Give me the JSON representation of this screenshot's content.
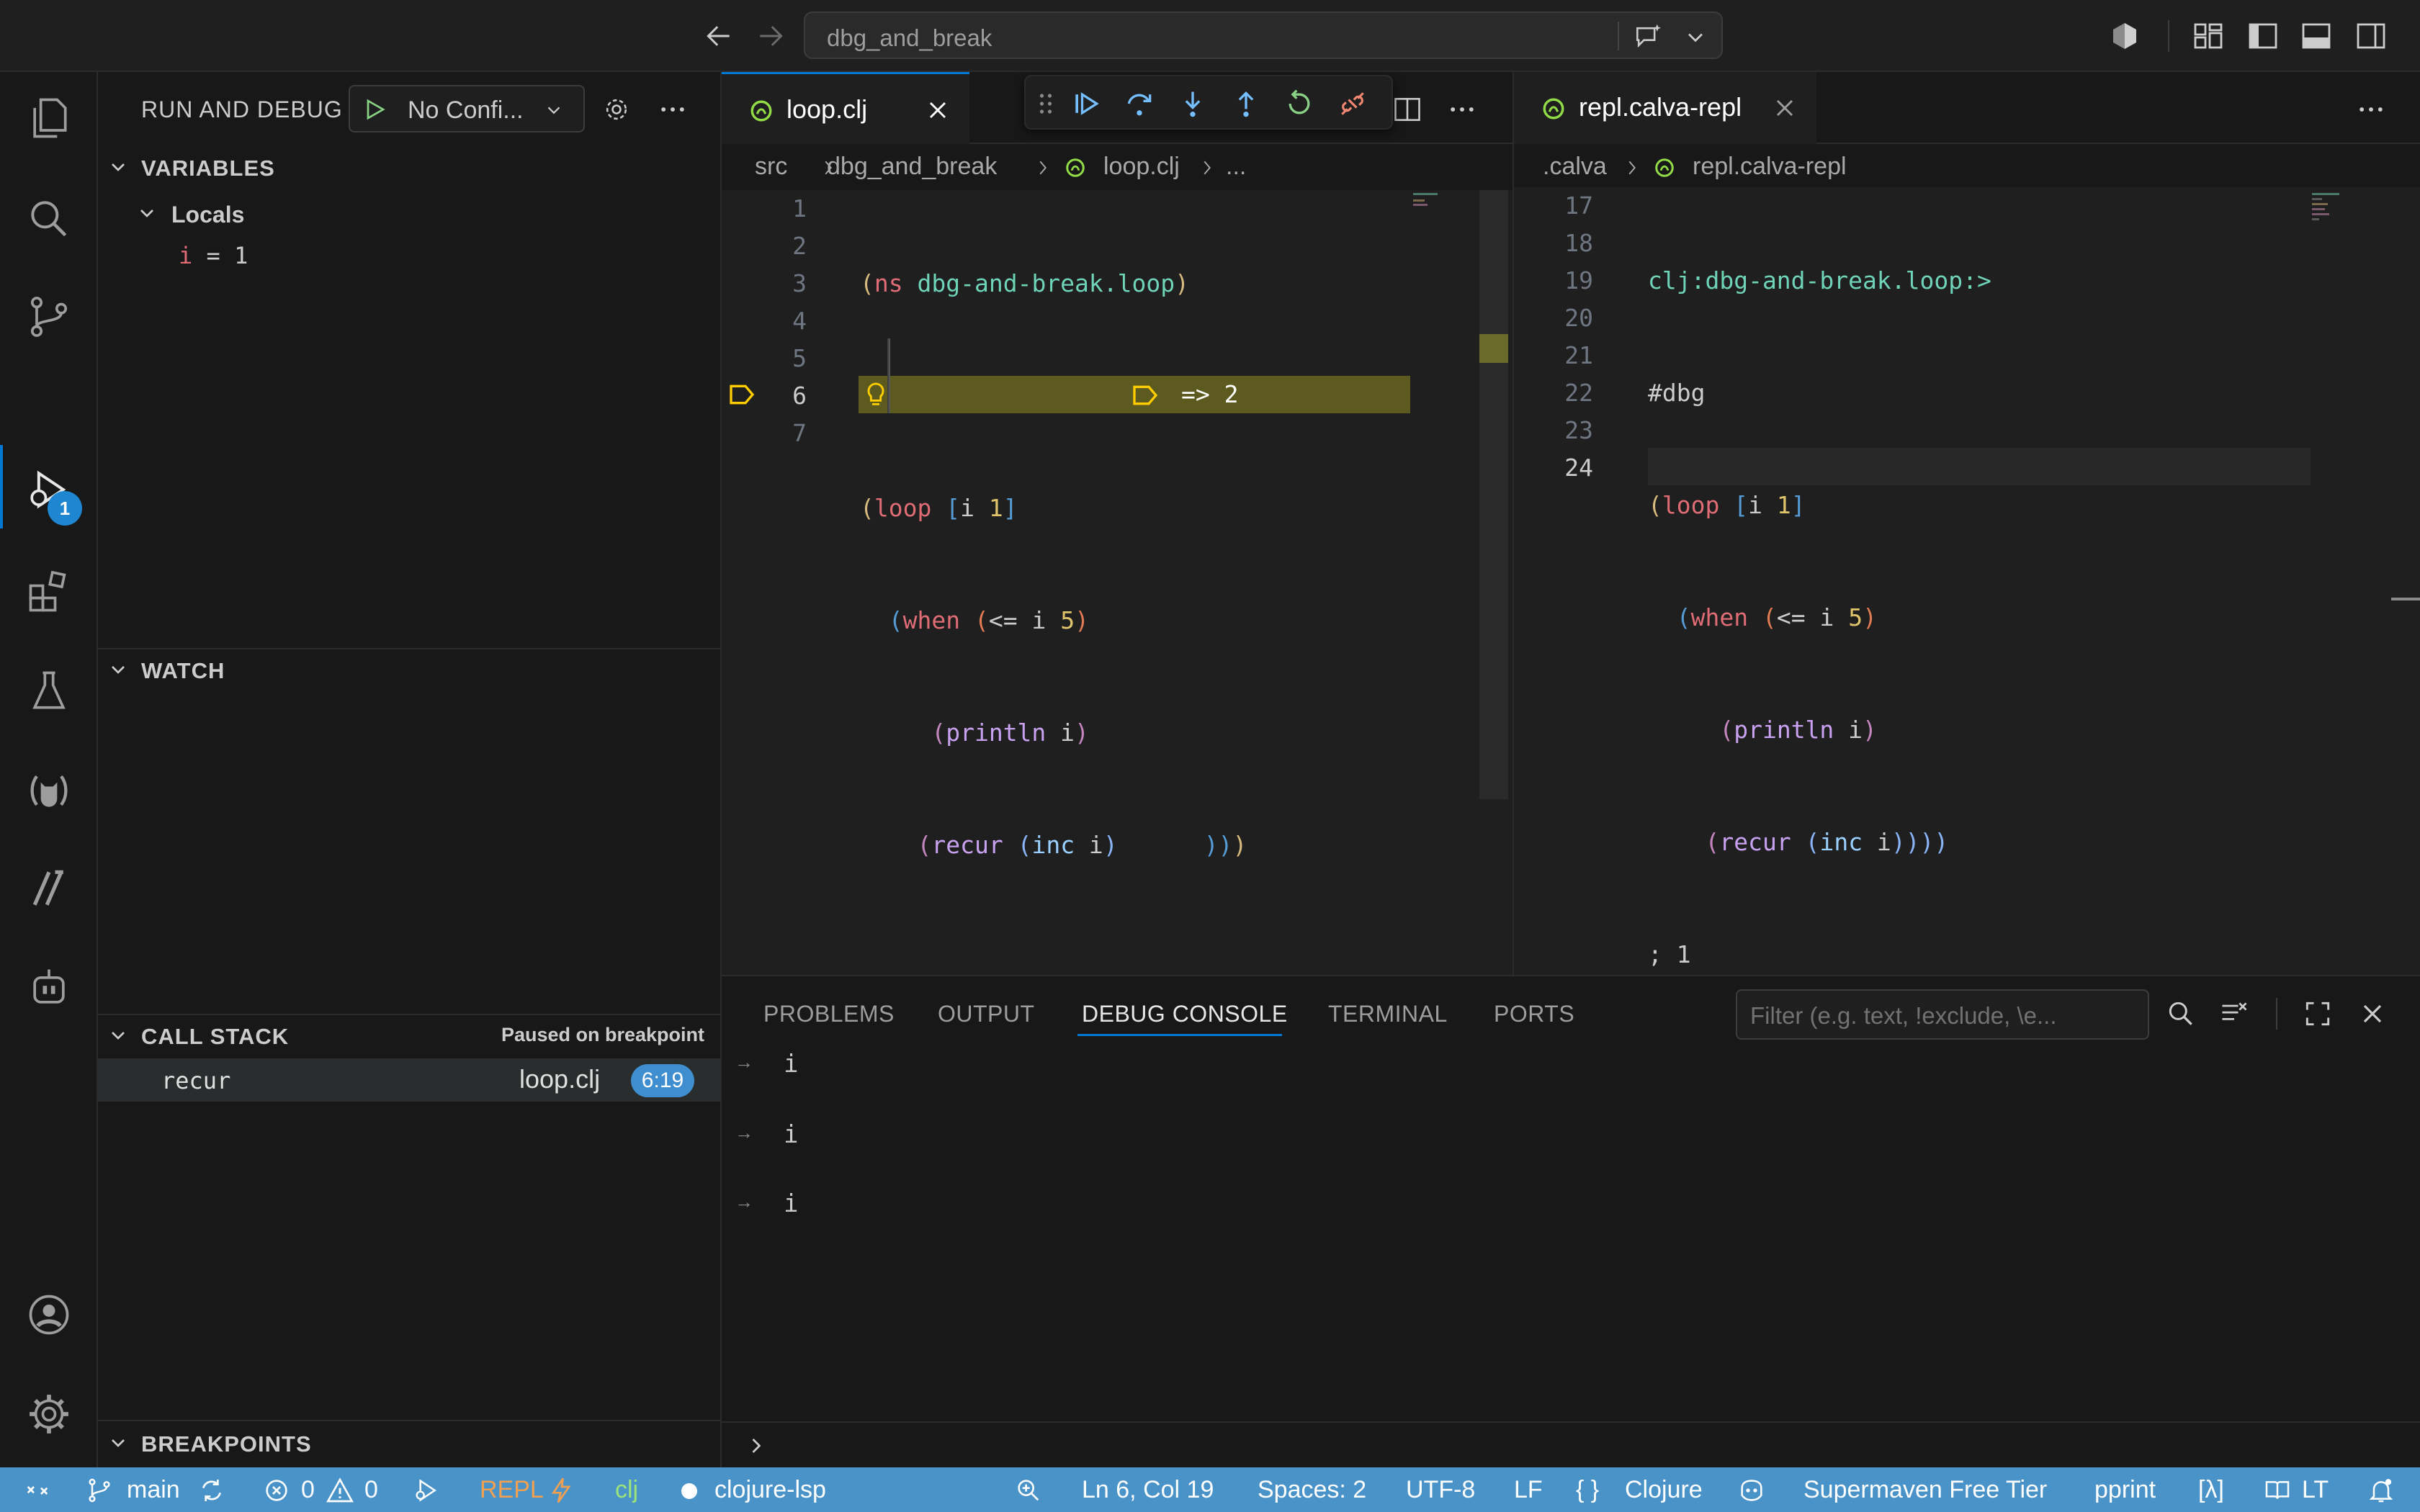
{
  "titlebar": {
    "search_text": "dbg_and_break"
  },
  "sidebar": {
    "title": "RUN AND DEBUG",
    "config_label": "No Confi...",
    "variables": {
      "header": "VARIABLES",
      "locals_label": "Locals",
      "vars": [
        {
          "name": "i",
          "eq": " = ",
          "value": "1"
        }
      ]
    },
    "watch": {
      "header": "WATCH"
    },
    "call_stack": {
      "header": "CALL STACK",
      "status": "Paused on breakpoint",
      "frames": [
        {
          "fn": "recur",
          "file": "loop.clj",
          "pos": "6:19"
        }
      ]
    },
    "breakpoints": {
      "header": "BREAKPOINTS"
    }
  },
  "editor_left": {
    "tab_name": "loop.clj",
    "breadcrumb": [
      "src",
      "dbg_and_break",
      "loop.clj",
      "..."
    ],
    "line_numbers": [
      "1",
      "2",
      "3",
      "4",
      "5",
      "6",
      "7"
    ],
    "current_line": "6",
    "inline_value": "=> 2",
    "tokens": {
      "l1": [
        "(",
        "ns",
        " ",
        "dbg-and-break.loop",
        ")"
      ],
      "l3": [
        "(",
        "loop",
        " ",
        "[",
        "i",
        " ",
        "1",
        "]"
      ],
      "l4": [
        "(",
        "when",
        " ",
        "(",
        "<=",
        " i ",
        "5",
        ")"
      ],
      "l5": [
        "(",
        "println",
        " i",
        ")"
      ],
      "l6": [
        "(",
        "recur",
        " ",
        "(",
        "inc",
        " i",
        ")",
        "))",
        ")"
      ]
    }
  },
  "editor_right": {
    "tab_name": "repl.calva-repl",
    "breadcrumb": [
      ".calva",
      "repl.calva-repl"
    ],
    "line_numbers": [
      "17",
      "18",
      "19",
      "20",
      "21",
      "22",
      "23",
      "24"
    ],
    "lines": {
      "l17": "clj:dbg-and-break.loop:>",
      "l18": "#dbg",
      "l19": [
        "(",
        "loop",
        " ",
        "[",
        "i",
        " ",
        "1",
        "]"
      ],
      "l20": [
        "(",
        "when",
        " ",
        "(",
        "<=",
        " i ",
        "5",
        ")"
      ],
      "l21": [
        "(",
        "println",
        " i",
        ")"
      ],
      "l22": [
        "(",
        "recur",
        " ",
        "(",
        "inc",
        " i",
        "))))"
      ],
      "l23": "; 1"
    }
  },
  "panel": {
    "tabs": [
      "PROBLEMS",
      "OUTPUT",
      "DEBUG CONSOLE",
      "TERMINAL",
      "PORTS"
    ],
    "active_tab": "DEBUG CONSOLE",
    "filter_placeholder": "Filter (e.g. text, !exclude, \\e...",
    "console_lines": [
      "i",
      "i",
      "i"
    ]
  },
  "statusbar": {
    "branch": "main",
    "errors": "0",
    "warnings": "0",
    "repl": "REPL",
    "lang_short": "clj",
    "lsp": "clojure-lsp",
    "position": "Ln 6, Col 19",
    "spaces": "Spaces: 2",
    "encoding": "UTF-8",
    "eol": "LF",
    "language": "Clojure",
    "supermaven": "Supermaven Free Tier",
    "pprint": "pprint",
    "lambda": "[λ]",
    "lt": "LT"
  },
  "colors": {
    "accent": "#0078d4",
    "statusbar": "#4a93c8",
    "breakpoint_highlight": "#5c5a1f",
    "breakpoint_yellow": "#ffcc00",
    "keyword": "#e06c75",
    "string_ns": "#6ed3b7",
    "paren_gold": "#d7ba7d",
    "paren_blue": "#569cd6",
    "paren_pink": "#c586c0",
    "number": "#e0c46c"
  }
}
